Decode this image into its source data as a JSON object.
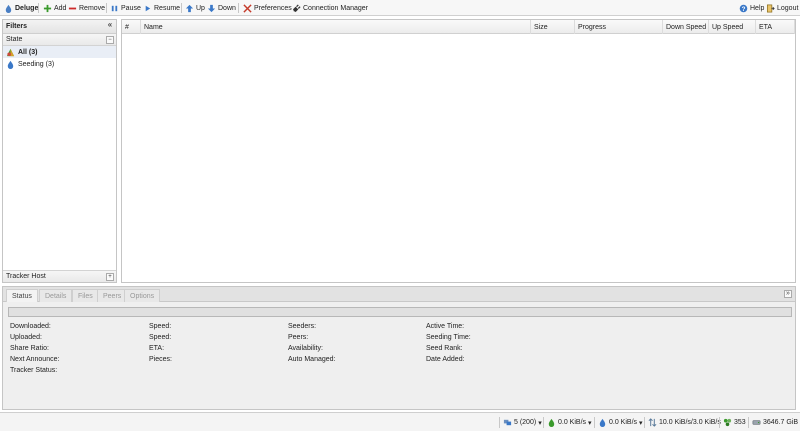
{
  "toolbar": {
    "brand": "Deluge",
    "add": "Add",
    "remove": "Remove",
    "pause": "Pause",
    "resume": "Resume",
    "up": "Up",
    "down": "Down",
    "preferences": "Preferences",
    "connection_manager": "Connection Manager",
    "help": "Help",
    "logout": "Logout"
  },
  "filters": {
    "title": "Filters",
    "state_header": "State",
    "items": [
      {
        "label": "All (3)",
        "icon": "all-states-icon"
      },
      {
        "label": "Seeding (3)",
        "icon": "seeding-icon"
      }
    ],
    "tracker_host": "Tracker Host"
  },
  "grid": {
    "columns": [
      "#",
      "Name",
      "Size",
      "Progress",
      "Down Speed",
      "Up Speed",
      "ETA"
    ]
  },
  "details": {
    "tabs": [
      "Status",
      "Details",
      "Files",
      "Peers",
      "Options"
    ],
    "progress": 0,
    "col1": [
      "Downloaded:",
      "Uploaded:",
      "Share Ratio:",
      "Next Announce:",
      "Tracker Status:"
    ],
    "col2": [
      "Speed:",
      "Speed:",
      "ETA:",
      "Pieces:"
    ],
    "col3": [
      "Seeders:",
      "Peers:",
      "Availability:",
      "Auto Managed:"
    ],
    "col4": [
      "Active Time:",
      "Seeding Time:",
      "Seed Rank:",
      "Date Added:"
    ]
  },
  "statusbar": {
    "connections": "5 (200)",
    "down_speed": "0.0 KiB/s",
    "up_speed": "0.0 KiB/s",
    "traffic": "10.0 KiB/s/3.0 KiB/s",
    "dht_nodes": "353",
    "free_space": "3646.7 GiB"
  },
  "colors": {
    "accent_green": "#3a9a2c",
    "accent_red": "#cc2a2a",
    "accent_blue": "#3a78c8"
  }
}
